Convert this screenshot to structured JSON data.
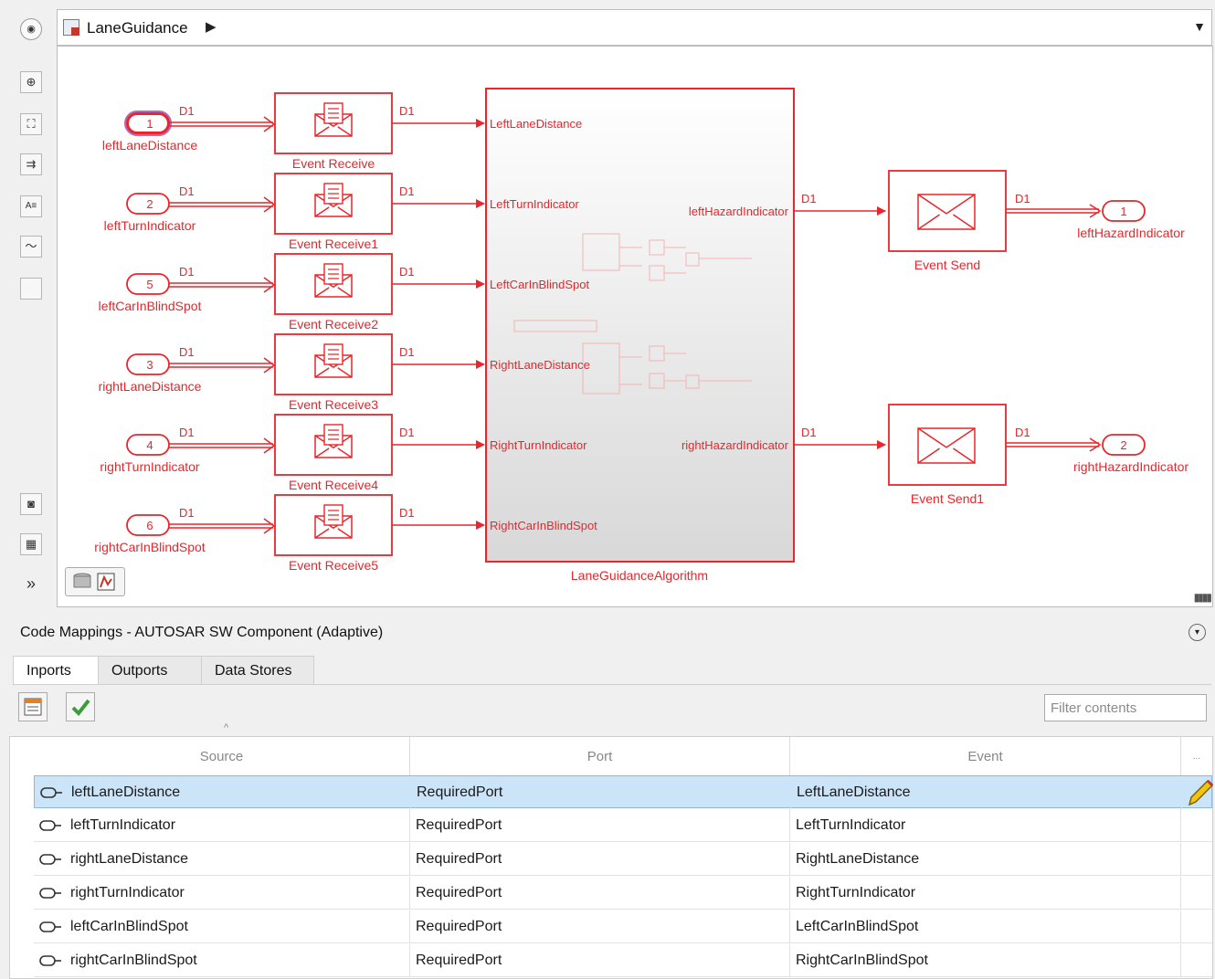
{
  "breadcrumb": {
    "model_name": "LaneGuidance"
  },
  "diagram": {
    "inports": [
      {
        "number": "1",
        "name": "leftLaneDistance",
        "signal": "D1",
        "receive_block": "Event Receive",
        "target_port": "LeftLaneDistance"
      },
      {
        "number": "2",
        "name": "leftTurnIndicator",
        "signal": "D1",
        "receive_block": "Event Receive1",
        "target_port": "LeftTurnIndicator"
      },
      {
        "number": "5",
        "name": "leftCarInBlindSpot",
        "signal": "D1",
        "receive_block": "Event Receive2",
        "target_port": "LeftCarInBlindSpot"
      },
      {
        "number": "3",
        "name": "rightLaneDistance",
        "signal": "D1",
        "receive_block": "Event Receive3",
        "target_port": "RightLaneDistance"
      },
      {
        "number": "4",
        "name": "rightTurnIndicator",
        "signal": "D1",
        "receive_block": "Event Receive4",
        "target_port": "RightTurnIndicator"
      },
      {
        "number": "6",
        "name": "rightCarInBlindSpot",
        "signal": "D1",
        "receive_block": "Event Receive5",
        "target_port": "RightCarInBlindSpot"
      }
    ],
    "subsystem": {
      "name": "LaneGuidanceAlgorithm",
      "outputs": [
        "leftHazardIndicator",
        "rightHazardIndicator"
      ]
    },
    "outports": [
      {
        "number": "1",
        "name": "leftHazardIndicator",
        "signal_in": "D1",
        "signal_out": "D1",
        "send_block": "Event Send"
      },
      {
        "number": "2",
        "name": "rightHazardIndicator",
        "signal_in": "D1",
        "signal_out": "D1",
        "send_block": "Event Send1"
      }
    ],
    "accent_color": "#e8262b"
  },
  "code_mappings": {
    "title": "Code Mappings - AUTOSAR SW Component (Adaptive)",
    "tabs": [
      "Inports",
      "Outports",
      "Data Stores"
    ],
    "active_tab": "Inports",
    "filter_placeholder": "Filter contents",
    "columns": [
      "Source",
      "Port",
      "Event",
      "..."
    ],
    "rows": [
      {
        "source": "leftLaneDistance",
        "port": "RequiredPort",
        "event": "LeftLaneDistance",
        "selected": true
      },
      {
        "source": "leftTurnIndicator",
        "port": "RequiredPort",
        "event": "LeftTurnIndicator",
        "selected": false
      },
      {
        "source": "rightLaneDistance",
        "port": "RequiredPort",
        "event": "RightLaneDistance",
        "selected": false
      },
      {
        "source": "rightTurnIndicator",
        "port": "RequiredPort",
        "event": "RightTurnIndicator",
        "selected": false
      },
      {
        "source": "leftCarInBlindSpot",
        "port": "RequiredPort",
        "event": "LeftCarInBlindSpot",
        "selected": false
      },
      {
        "source": "rightCarInBlindSpot",
        "port": "RequiredPort",
        "event": "RightCarInBlindSpot",
        "selected": false
      }
    ],
    "selection_color": "#cce4f7"
  }
}
